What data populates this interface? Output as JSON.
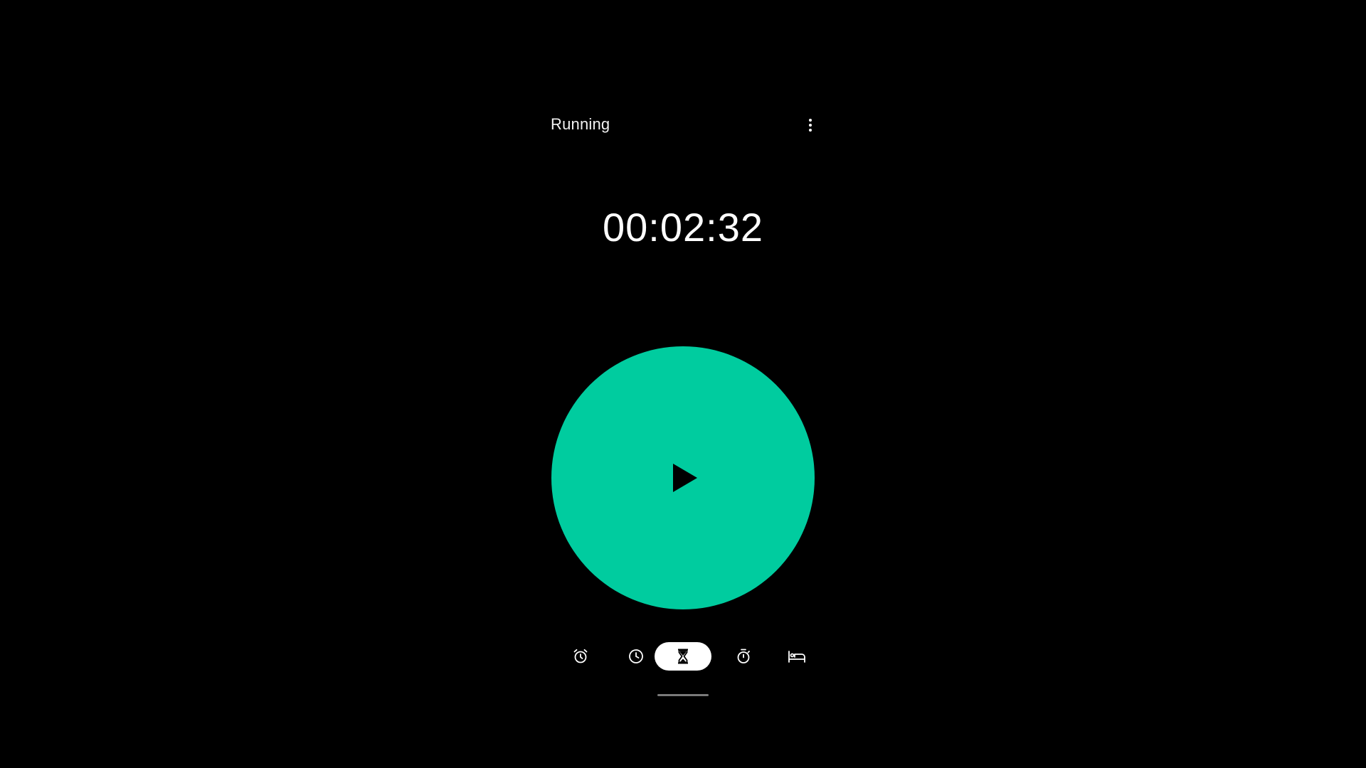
{
  "header": {
    "title": "Running",
    "menu_icon": "more-vert-icon"
  },
  "timer": {
    "remaining": "00:02:32",
    "state": "paused"
  },
  "play_button": {
    "icon": "play-icon",
    "color": "#00cc9f"
  },
  "nav": {
    "items": [
      {
        "icon": "alarm-icon",
        "active": false
      },
      {
        "icon": "clock-icon",
        "active": false
      },
      {
        "icon": "hourglass-icon",
        "active": true
      },
      {
        "icon": "stopwatch-icon",
        "active": false
      },
      {
        "icon": "bed-icon",
        "active": false
      }
    ]
  },
  "colors": {
    "background": "#000000",
    "accent": "#00cc9f",
    "text": "#ffffff"
  }
}
